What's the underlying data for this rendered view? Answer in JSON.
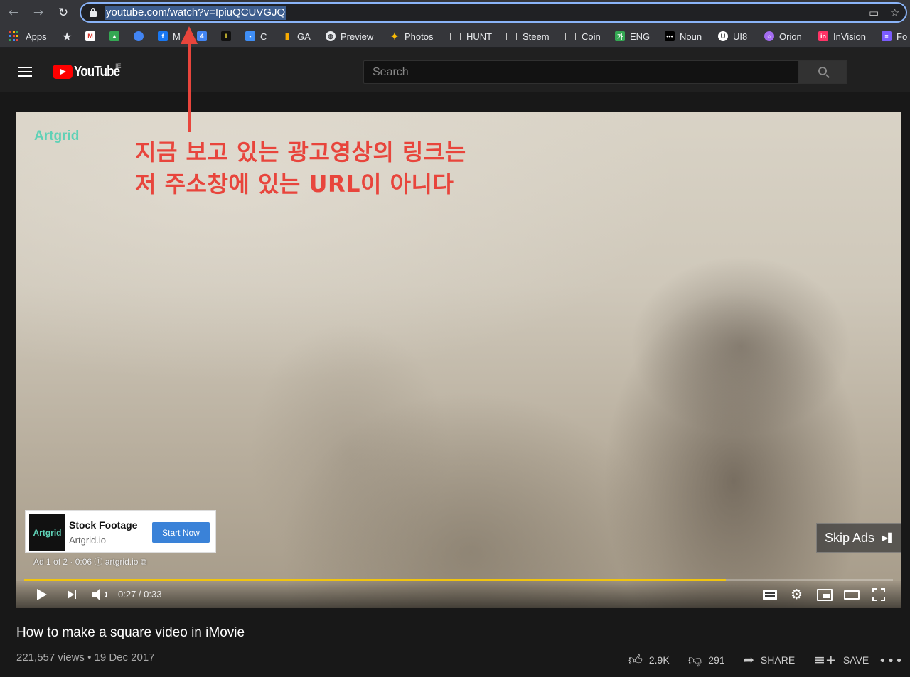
{
  "browser": {
    "url": "youtube.com/watch?v=IpiuQCUVGJQ",
    "bookmarks": [
      {
        "label": "Apps",
        "icon": "apps-grid-icon"
      },
      {
        "label": "",
        "icon": "star-icon"
      },
      {
        "label": "",
        "icon": "gmail-icon",
        "color": "#d93025"
      },
      {
        "label": "",
        "icon": "photo-icon",
        "color": "#34a853"
      },
      {
        "label": "",
        "icon": "chat-icon",
        "color": "#4285f4"
      },
      {
        "label": "M",
        "icon": "facebook-icon",
        "color": "#1877f2"
      },
      {
        "label": "",
        "icon": "calendar-icon",
        "color": "#4285f4"
      },
      {
        "label": "",
        "icon": "instapaper-icon",
        "color": "#111111"
      },
      {
        "label": "C",
        "icon": "chat-bubble-icon",
        "color": "#3f8ef5"
      },
      {
        "label": "GA",
        "icon": "analytics-icon",
        "color": "#f9ab00"
      },
      {
        "label": "Preview",
        "icon": "globe-icon"
      },
      {
        "label": "Photos",
        "icon": "pinwheel-icon"
      },
      {
        "label": "HUNT",
        "icon": "folder-icon"
      },
      {
        "label": "Steem",
        "icon": "folder-icon"
      },
      {
        "label": "Coin",
        "icon": "folder-icon"
      },
      {
        "label": "ENG",
        "icon": "translate-icon",
        "color": "#34a853"
      },
      {
        "label": "Noun",
        "icon": "dots-icon",
        "color": "#000000"
      },
      {
        "label": "UI8",
        "icon": "ui8-icon"
      },
      {
        "label": "Orion",
        "icon": "orion-icon",
        "color": "#a36cf0"
      },
      {
        "label": "InVision",
        "icon": "invision-icon",
        "color": "#ff3366"
      },
      {
        "label": "Fo",
        "icon": "list-icon",
        "color": "#7b5cff"
      }
    ]
  },
  "header": {
    "logo": "YouTube",
    "region": "IE",
    "search_placeholder": "Search"
  },
  "player": {
    "watermark": "Artgrid",
    "annotation_line1": "지금 보고 있는 광고영상의 링크는",
    "annotation_line2": "저 주소창에 있는 URL이 아니다",
    "ad": {
      "thumb_label": "Artgrid",
      "title": "Stock Footage",
      "domain": "Artgrid.io",
      "cta": "Start Now",
      "meta": "Ad 1 of 2 · 0:06 ⓘ   artgrid.io ⧉"
    },
    "skip_label": "Skip Ads",
    "time": "0:27 / 0:33",
    "progress": 0.808
  },
  "video": {
    "title": "How to make a square video in iMovie",
    "meta": "221,557 views • 19 Dec 2017",
    "likes": "2.9K",
    "dislikes": "291",
    "share": "SHARE",
    "save": "SAVE"
  }
}
